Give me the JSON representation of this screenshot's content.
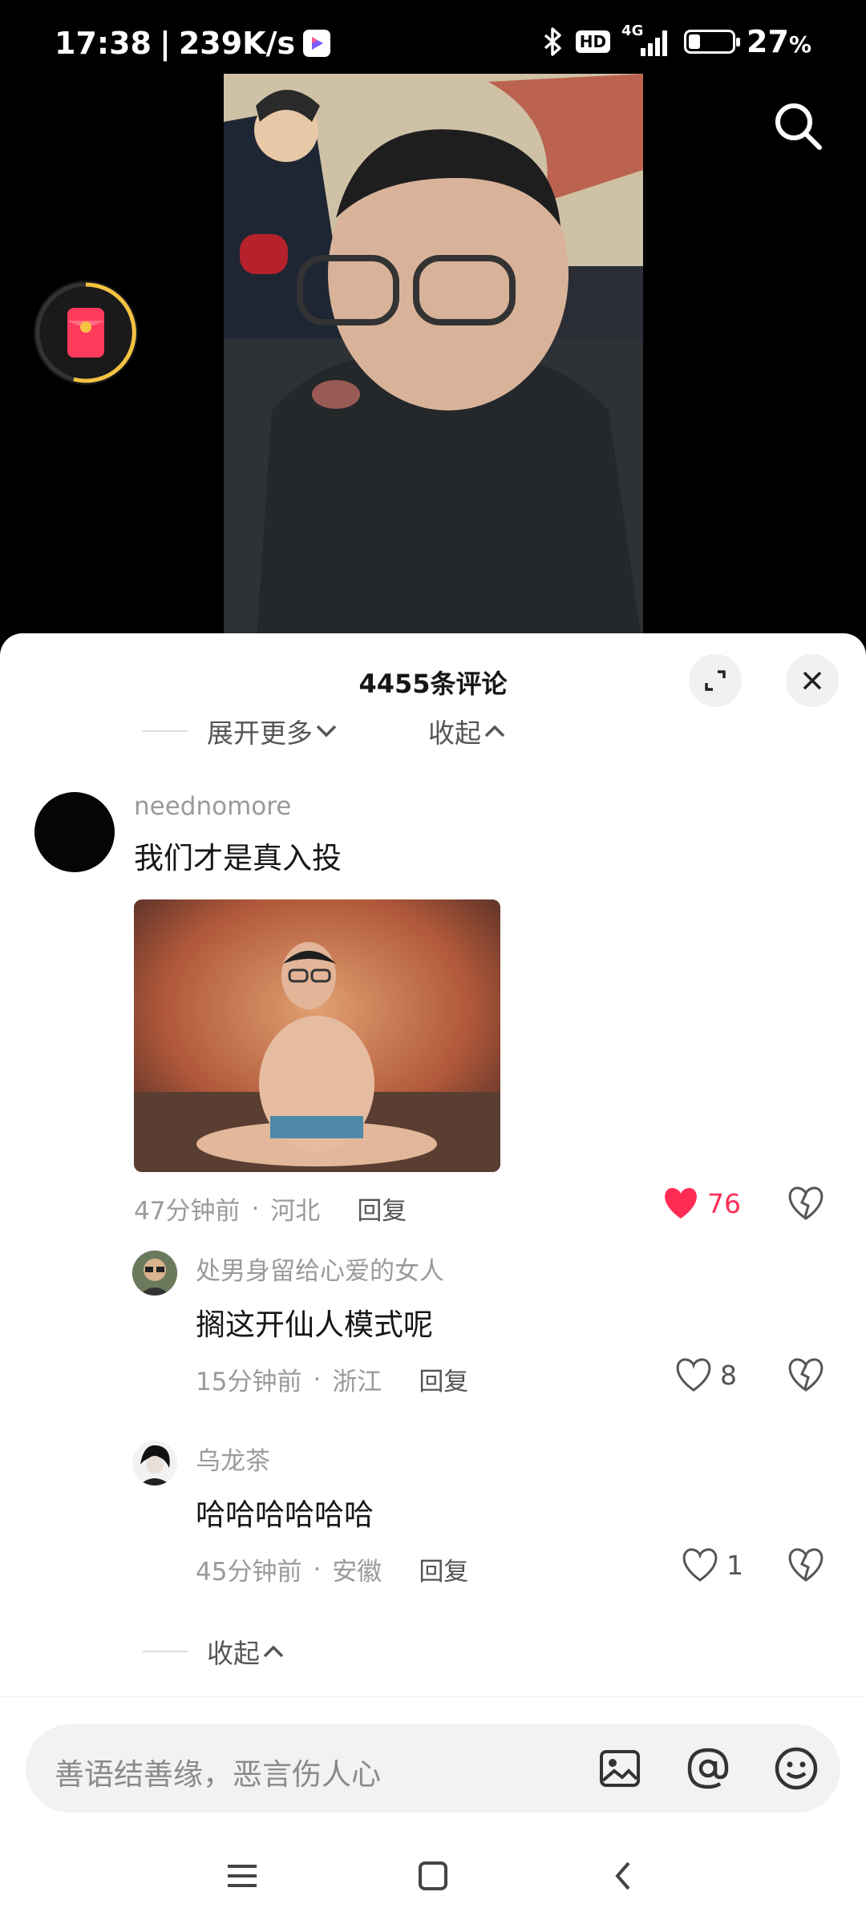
{
  "status_bar": {
    "time": "17:38",
    "network_speed": "239K/s",
    "network_type": "4G",
    "hd_badge": "HD",
    "battery_percent": "27",
    "battery_unit": "%",
    "battery_level": 0.27
  },
  "video": {
    "search_icon": "search-icon",
    "red_packet_icon": "red-packet-icon"
  },
  "comments_sheet": {
    "title": "4455条评论",
    "expand_more": "展开更多",
    "collapse": "收起",
    "comments": [
      {
        "username": "neednomore",
        "text": "我们才是真入投",
        "time": "47分钟前",
        "location": "河北",
        "reply": "回复",
        "likes": "76",
        "liked": true,
        "has_image": true
      }
    ],
    "replies": [
      {
        "username": "处男身留给心爱的女人",
        "text": "搁这开仙人模式呢",
        "time": "15分钟前",
        "location": "浙江",
        "reply": "回复",
        "likes": "8"
      },
      {
        "username": "乌龙茶",
        "text": "哈哈哈哈哈哈",
        "time": "45分钟前",
        "location": "安徽",
        "reply": "回复",
        "likes": "1"
      }
    ],
    "collapse_bottom": "收起",
    "separator": "·"
  },
  "input_bar": {
    "placeholder": "善语结善缘，恶言伤人心"
  },
  "colors": {
    "like_red": "#fe2c55",
    "text_primary": "#161616",
    "text_secondary": "#9a9a9a"
  }
}
